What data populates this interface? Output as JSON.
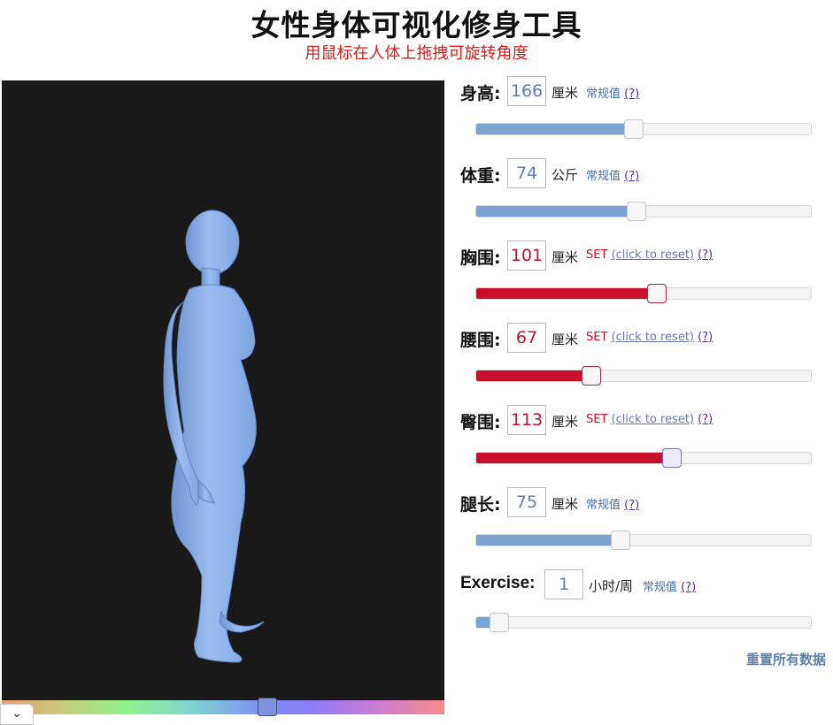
{
  "header": {
    "title": "女性身体可视化修身工具",
    "subtitle": "用鼠标在人体上拖拽可旋转角度"
  },
  "sliders": [
    {
      "id": "height",
      "label": "身高:",
      "value": "166",
      "unit": "厘米",
      "status": "normal",
      "normal_text": "常规值",
      "help": "(?)",
      "fraction": 0.47
    },
    {
      "id": "weight",
      "label": "体重:",
      "value": "74",
      "unit": "公斤",
      "status": "normal",
      "normal_text": "常规值",
      "help": "(?)",
      "fraction": 0.48
    },
    {
      "id": "bust",
      "label": "胸围:",
      "value": "101",
      "unit": "厘米",
      "status": "set",
      "set_text": "SET",
      "reset_text": "(click to reset)",
      "help": "(?)",
      "fraction": 0.54
    },
    {
      "id": "waist",
      "label": "腰围:",
      "value": "67",
      "unit": "厘米",
      "status": "set",
      "set_text": "SET",
      "reset_text": "(click to reset)",
      "help": "(?)",
      "fraction": 0.345
    },
    {
      "id": "hips",
      "label": "臀围:",
      "value": "113",
      "unit": "厘米",
      "status": "set",
      "set_text": "SET",
      "reset_text": "(click to reset)",
      "help": "(?)",
      "fraction": 0.585
    },
    {
      "id": "inseam",
      "label": "腿长:",
      "value": "75",
      "unit": "厘米",
      "status": "normal",
      "normal_text": "常规值",
      "help": "(?)",
      "fraction": 0.43
    },
    {
      "id": "exercise",
      "label": "Exercise:",
      "value": "1",
      "unit": "小时/周",
      "status": "normal",
      "normal_text": "常规值",
      "help": "(?)",
      "fraction": 0.07
    }
  ],
  "reset_all": "重置所有数据",
  "color_slider": {
    "fraction": 0.6
  },
  "colors": {
    "model": "#8db3ee",
    "normal": "#7ba3d2",
    "set": "#c8102e",
    "background": "#191919"
  }
}
